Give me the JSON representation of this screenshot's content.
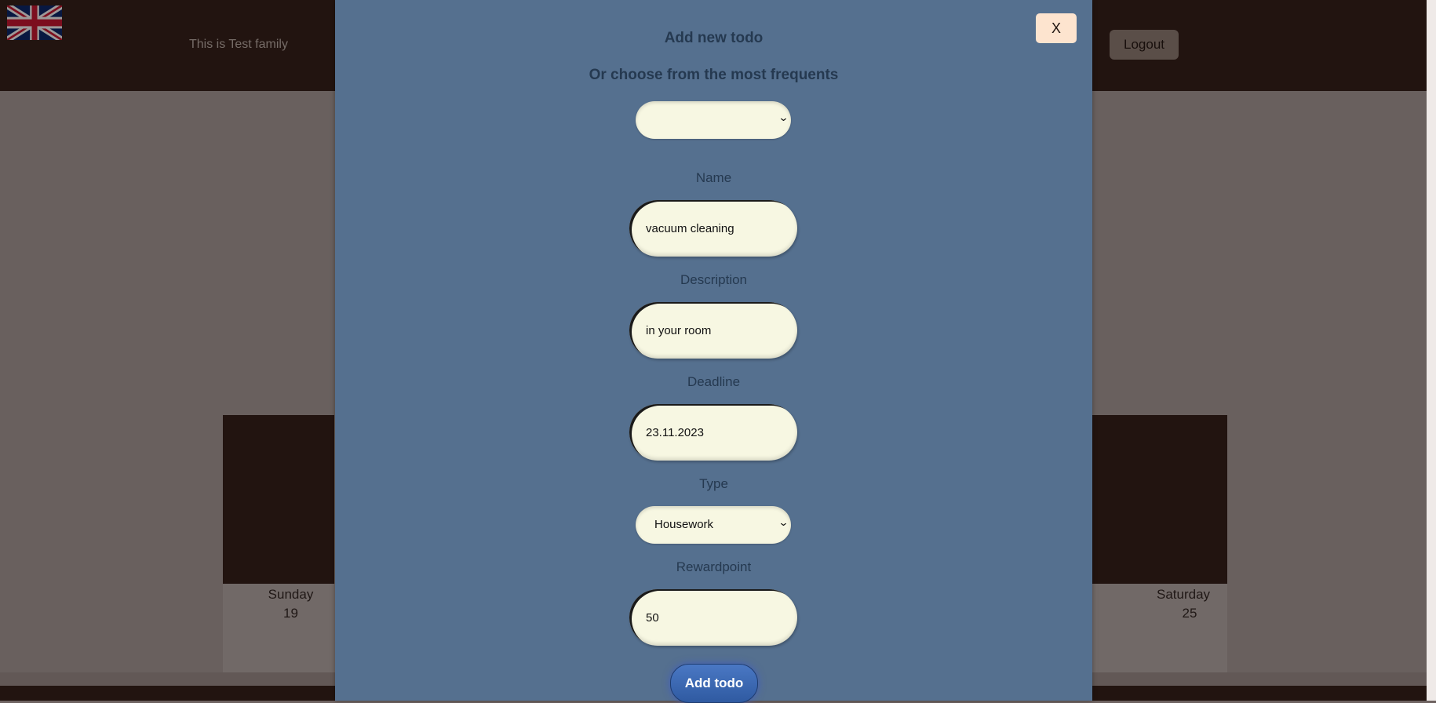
{
  "header": {
    "family_text": "This is Test family",
    "logout_label": "Logout"
  },
  "calendar": {
    "days": [
      {
        "name": "Sunday",
        "date": "19"
      },
      {
        "name": "Saturday",
        "date": "25"
      }
    ]
  },
  "modal": {
    "close_label": "X",
    "title": "Add new todo",
    "subtitle": "Or choose from the most frequents",
    "frequent_select_value": "",
    "fields": {
      "name_label": "Name",
      "name_value": "vacuum cleaning",
      "description_label": "Description",
      "description_value": "in your room",
      "deadline_label": "Deadline",
      "deadline_value": "23.11.2023",
      "type_label": "Type",
      "type_value": "Housework",
      "rewardpoint_label": "Rewardpoint",
      "rewardpoint_value": "50"
    },
    "submit_label": "Add todo"
  },
  "icons": {
    "flag": "uk-flag-icon",
    "chevron": "chevron-down-icon"
  },
  "colors": {
    "header_bg": "#2d1a15",
    "modal_bg": "#55708f",
    "input_bg": "#f7f7e2",
    "button_bg": "#3a65b0"
  }
}
